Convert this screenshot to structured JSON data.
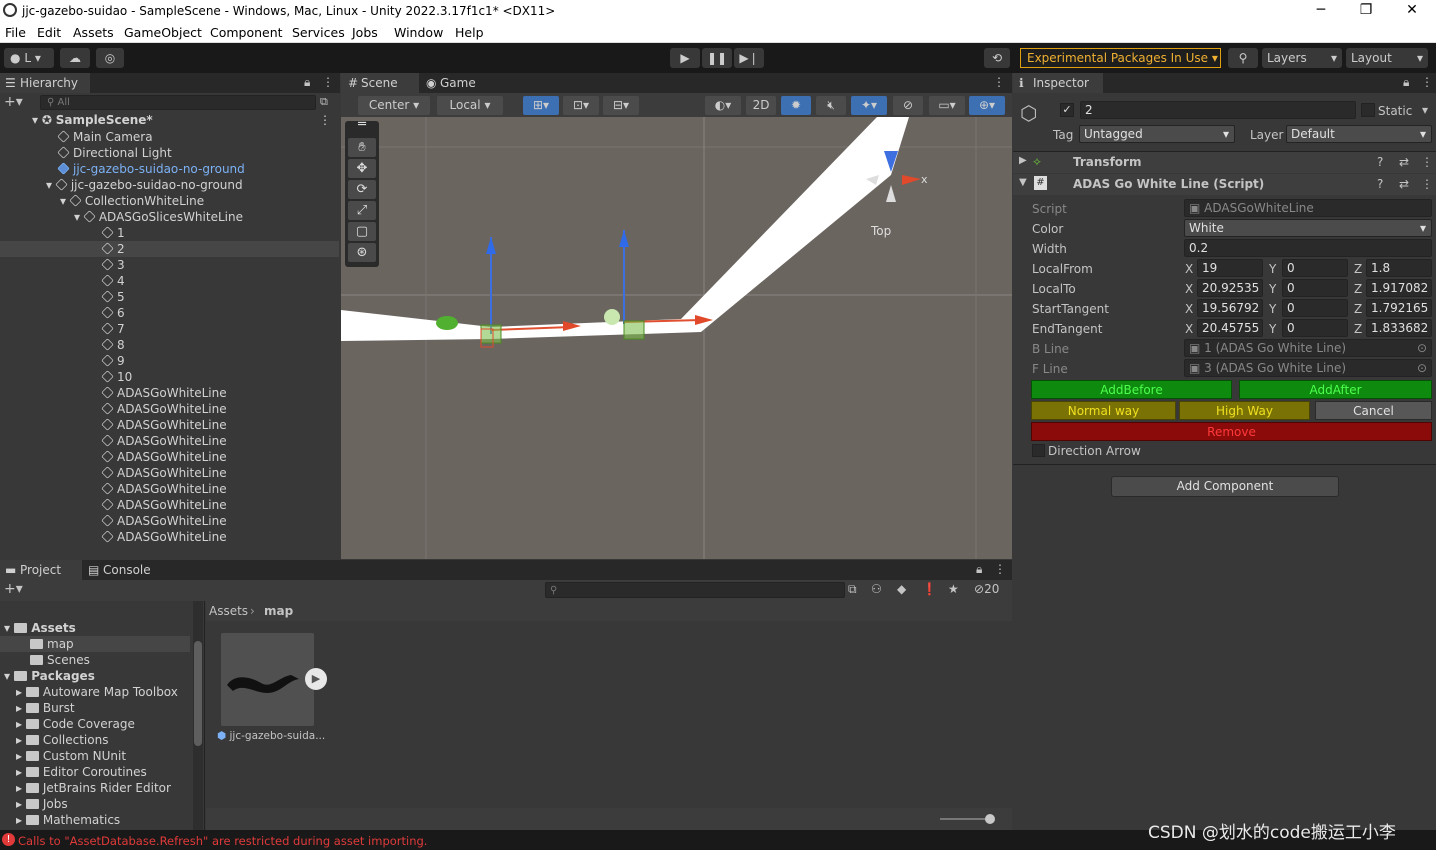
{
  "window": {
    "title": "jjc-gazebo-suidao - SampleScene - Windows, Mac, Linux - Unity 2022.3.17f1c1* <DX11>",
    "minimize": "─",
    "maximize": "❐",
    "close": "✕"
  },
  "menu": [
    "File",
    "Edit",
    "Assets",
    "GameObject",
    "Component",
    "Services",
    "Jobs",
    "Window",
    "Help"
  ],
  "toolbar": {
    "account": "L",
    "experimental": "Experimental Packages In Use",
    "layers": "Layers",
    "layout": "Layout"
  },
  "hierarchy": {
    "tab": "Hierarchy",
    "search_placeholder": "All",
    "scene": "SampleScene*",
    "items": [
      {
        "label": "Main Camera"
      },
      {
        "label": "Directional Light"
      },
      {
        "label": "jjc-gazebo-suidao-no-ground"
      },
      {
        "label": "jjc-gazebo-suidao-no-ground"
      },
      {
        "label": "CollectionWhiteLine"
      },
      {
        "label": "ADASGoSlicesWhiteLine"
      },
      {
        "label": "1"
      },
      {
        "label": "2"
      },
      {
        "label": "3"
      },
      {
        "label": "4"
      },
      {
        "label": "5"
      },
      {
        "label": "6"
      },
      {
        "label": "7"
      },
      {
        "label": "8"
      },
      {
        "label": "9"
      },
      {
        "label": "10"
      },
      {
        "label": "ADASGoWhiteLine"
      },
      {
        "label": "ADASGoWhiteLine"
      },
      {
        "label": "ADASGoWhiteLine"
      },
      {
        "label": "ADASGoWhiteLine"
      },
      {
        "label": "ADASGoWhiteLine"
      },
      {
        "label": "ADASGoWhiteLine"
      },
      {
        "label": "ADASGoWhiteLine"
      },
      {
        "label": "ADASGoWhiteLine"
      },
      {
        "label": "ADASGoWhiteLine"
      },
      {
        "label": "ADASGoWhiteLine"
      }
    ]
  },
  "scene": {
    "tab_scene": "Scene",
    "tab_game": "Game",
    "pivot": "Center",
    "space": "Local",
    "mode2d": "2D",
    "gizmo_label": "Top",
    "axis_x": "x"
  },
  "inspector": {
    "tab": "Inspector",
    "name": "2",
    "static": "Static",
    "tag_label": "Tag",
    "tag": "Untagged",
    "layer_label": "Layer",
    "layer": "Default",
    "transform": "Transform",
    "script_header": "ADAS Go White Line (Script)",
    "fields": {
      "script_label": "Script",
      "script": "ADASGoWhiteLine",
      "color_label": "Color",
      "color": "White",
      "width_label": "Width",
      "width": "0.2",
      "localfrom_label": "LocalFrom",
      "localfrom": [
        "19",
        "0",
        "1.8"
      ],
      "localto_label": "LocalTo",
      "localto": [
        "20.92535",
        "0",
        "1.917082"
      ],
      "starttangent_label": "StartTangent",
      "starttangent": [
        "19.56792",
        "0",
        "1.792165"
      ],
      "endtangent_label": "EndTangent",
      "endtangent": [
        "20.45755",
        "0",
        "1.833682"
      ],
      "bline_label": "B Line",
      "bline": "1 (ADAS Go White Line)",
      "fline_label": "F Line",
      "fline": "3 (ADAS Go White Line)"
    },
    "axis": [
      "X",
      "Y",
      "Z"
    ],
    "buttons": {
      "add_before": "AddBefore",
      "add_after": "AddAfter",
      "normal_way": "Normal way",
      "high_way": "High Way",
      "cancel": "Cancel",
      "remove": "Remove"
    },
    "direction_arrow": "Direction Arrow",
    "add_component": "Add Component",
    "colors": {
      "green": "#0e8a0e",
      "yellow": "#7a7205",
      "red": "#8b0a0a"
    }
  },
  "project": {
    "tab_project": "Project",
    "tab_console": "Console",
    "hidden_count": "20",
    "breadcrumb": [
      "Assets",
      "map"
    ],
    "tree": [
      {
        "label": "Assets",
        "bold": true
      },
      {
        "label": "map"
      },
      {
        "label": "Scenes"
      },
      {
        "label": "Packages",
        "bold": true
      },
      {
        "label": "Autoware Map Toolbox"
      },
      {
        "label": "Burst"
      },
      {
        "label": "Code Coverage"
      },
      {
        "label": "Collections"
      },
      {
        "label": "Custom NUnit"
      },
      {
        "label": "Editor Coroutines"
      },
      {
        "label": "JetBrains Rider Editor"
      },
      {
        "label": "Jobs"
      },
      {
        "label": "Mathematics"
      }
    ],
    "asset": "jjc-gazebo-suida..."
  },
  "status": {
    "error": "Calls to \"AssetDatabase.Refresh\" are restricted during asset importing.",
    "watermark": "CSDN @划水的code搬运工小李"
  }
}
